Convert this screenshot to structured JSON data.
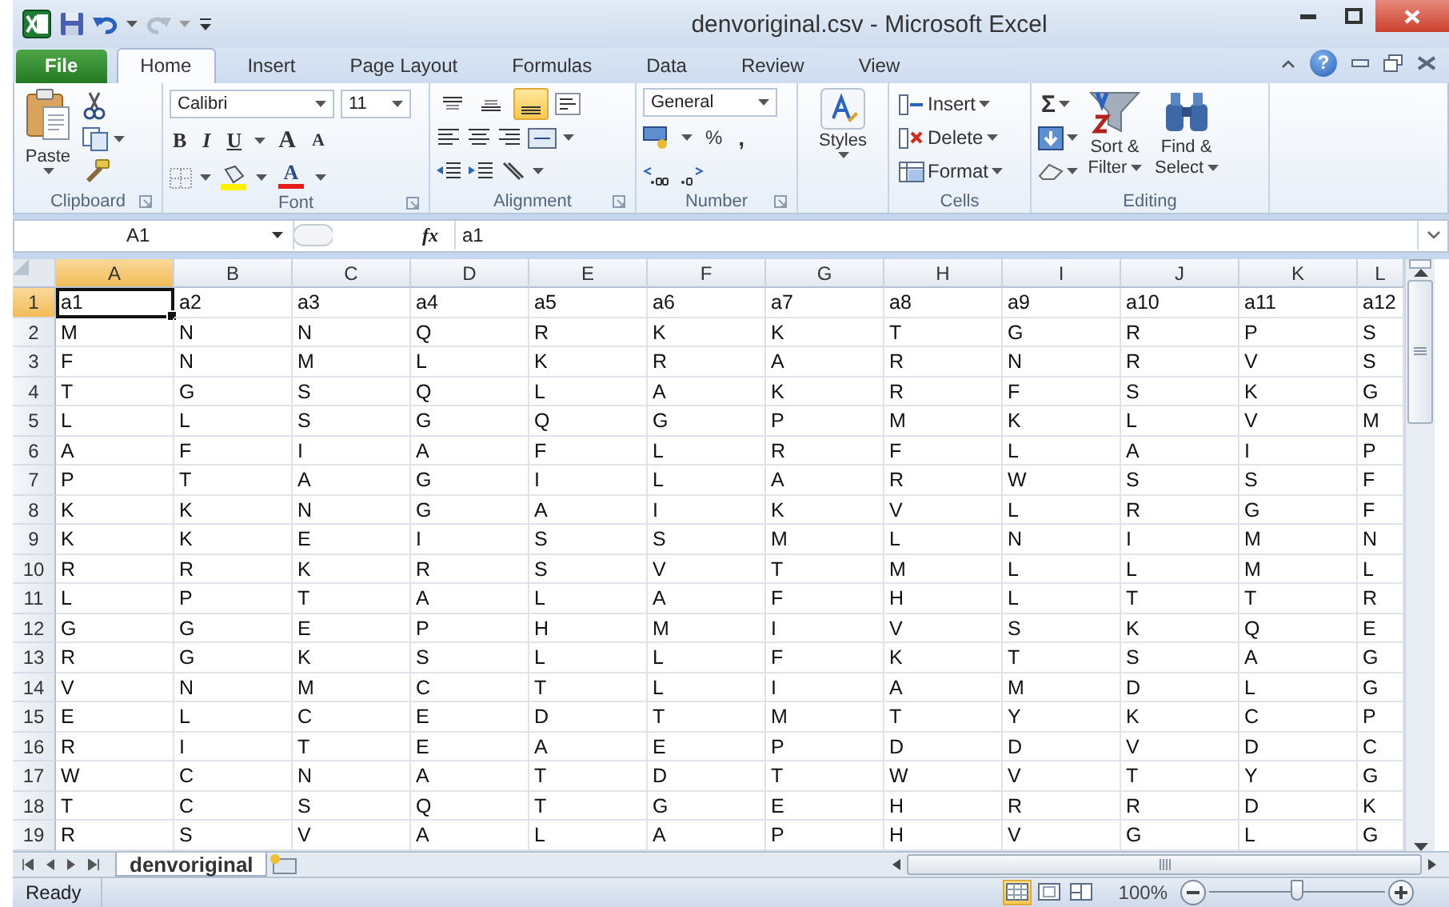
{
  "window": {
    "title": "denvoriginal.csv - Microsoft Excel"
  },
  "ribbon_tabs": [
    {
      "label": "File",
      "kind": "file",
      "selected": false
    },
    {
      "label": "Home",
      "kind": "tab",
      "selected": true
    },
    {
      "label": "Insert",
      "kind": "tab",
      "selected": false
    },
    {
      "label": "Page Layout",
      "kind": "tab",
      "selected": false
    },
    {
      "label": "Formulas",
      "kind": "tab",
      "selected": false
    },
    {
      "label": "Data",
      "kind": "tab",
      "selected": false
    },
    {
      "label": "Review",
      "kind": "tab",
      "selected": false
    },
    {
      "label": "View",
      "kind": "tab",
      "selected": false
    }
  ],
  "help_button": "?",
  "ribbon": {
    "clipboard": {
      "label": "Clipboard",
      "paste": "Paste"
    },
    "font": {
      "label": "Font",
      "name": "Calibri",
      "size": "11",
      "bold": "B",
      "italic": "I",
      "underline": "U",
      "grow": "A",
      "shrink": "A",
      "font_color_button": "A"
    },
    "alignment": {
      "label": "Alignment",
      "vertical": [
        {
          "selected": false
        },
        {
          "selected": false
        },
        {
          "selected": true
        }
      ]
    },
    "number": {
      "label": "Number",
      "format": "General",
      "percent": "%",
      "comma": ","
    },
    "styles": {
      "label": "Styles"
    },
    "cells": {
      "label": "Cells",
      "buttons": [
        "Insert",
        "Delete",
        "Format"
      ]
    },
    "editing": {
      "label": "Editing",
      "autosum": "Σ",
      "sort": [
        "Sort &",
        "Filter"
      ],
      "find": [
        "Find &",
        "Select"
      ]
    }
  },
  "formula_bar": {
    "name_box": "A1",
    "fx": "fx",
    "formula": "a1"
  },
  "sheet": {
    "columns": [
      {
        "label": "A",
        "selected": true
      },
      {
        "label": "B",
        "selected": false
      },
      {
        "label": "C",
        "selected": false
      },
      {
        "label": "D",
        "selected": false
      },
      {
        "label": "E",
        "selected": false
      },
      {
        "label": "F",
        "selected": false
      },
      {
        "label": "G",
        "selected": false
      },
      {
        "label": "H",
        "selected": false
      },
      {
        "label": "I",
        "selected": false
      },
      {
        "label": "J",
        "selected": false
      },
      {
        "label": "K",
        "selected": false
      },
      {
        "label": "L",
        "selected": false
      }
    ],
    "rows": [
      {
        "number": "1",
        "selected": true,
        "cells": [
          "a1",
          "a2",
          "a3",
          "a4",
          "a5",
          "a6",
          "a7",
          "a8",
          "a9",
          "a10",
          "a11",
          "a12"
        ]
      },
      {
        "number": "2",
        "selected": false,
        "cells": [
          "M",
          "N",
          "N",
          "Q",
          "R",
          "K",
          "K",
          "T",
          "G",
          "R",
          "P",
          "S"
        ]
      },
      {
        "number": "3",
        "selected": false,
        "cells": [
          "F",
          "N",
          "M",
          "L",
          "K",
          "R",
          "A",
          "R",
          "N",
          "R",
          "V",
          "S"
        ]
      },
      {
        "number": "4",
        "selected": false,
        "cells": [
          "T",
          "G",
          "S",
          "Q",
          "L",
          "A",
          "K",
          "R",
          "F",
          "S",
          "K",
          "G"
        ]
      },
      {
        "number": "5",
        "selected": false,
        "cells": [
          "L",
          "L",
          "S",
          "G",
          "Q",
          "G",
          "P",
          "M",
          "K",
          "L",
          "V",
          "M"
        ]
      },
      {
        "number": "6",
        "selected": false,
        "cells": [
          "A",
          "F",
          "I",
          "A",
          "F",
          "L",
          "R",
          "F",
          "L",
          "A",
          "I",
          "P"
        ]
      },
      {
        "number": "7",
        "selected": false,
        "cells": [
          "P",
          "T",
          "A",
          "G",
          "I",
          "L",
          "A",
          "R",
          "W",
          "S",
          "S",
          "F"
        ]
      },
      {
        "number": "8",
        "selected": false,
        "cells": [
          "K",
          "K",
          "N",
          "G",
          "A",
          "I",
          "K",
          "V",
          "L",
          "R",
          "G",
          "F"
        ]
      },
      {
        "number": "9",
        "selected": false,
        "cells": [
          "K",
          "K",
          "E",
          "I",
          "S",
          "S",
          "M",
          "L",
          "N",
          "I",
          "M",
          "N"
        ]
      },
      {
        "number": "10",
        "selected": false,
        "cells": [
          "R",
          "R",
          "K",
          "R",
          "S",
          "V",
          "T",
          "M",
          "L",
          "L",
          "M",
          "L"
        ]
      },
      {
        "number": "11",
        "selected": false,
        "cells": [
          "L",
          "P",
          "T",
          "A",
          "L",
          "A",
          "F",
          "H",
          "L",
          "T",
          "T",
          "R"
        ]
      },
      {
        "number": "12",
        "selected": false,
        "cells": [
          "G",
          "G",
          "E",
          "P",
          "H",
          "M",
          "I",
          "V",
          "S",
          "K",
          "Q",
          "E"
        ]
      },
      {
        "number": "13",
        "selected": false,
        "cells": [
          "R",
          "G",
          "K",
          "S",
          "L",
          "L",
          "F",
          "K",
          "T",
          "S",
          "A",
          "G"
        ]
      },
      {
        "number": "14",
        "selected": false,
        "cells": [
          "V",
          "N",
          "M",
          "C",
          "T",
          "L",
          "I",
          "A",
          "M",
          "D",
          "L",
          "G"
        ]
      },
      {
        "number": "15",
        "selected": false,
        "cells": [
          "E",
          "L",
          "C",
          "E",
          "D",
          "T",
          "M",
          "T",
          "Y",
          "K",
          "C",
          "P"
        ]
      },
      {
        "number": "16",
        "selected": false,
        "cells": [
          "R",
          "I",
          "T",
          "E",
          "A",
          "E",
          "P",
          "D",
          "D",
          "V",
          "D",
          "C"
        ]
      },
      {
        "number": "17",
        "selected": false,
        "cells": [
          "W",
          "C",
          "N",
          "A",
          "T",
          "D",
          "T",
          "W",
          "V",
          "T",
          "Y",
          "G"
        ]
      },
      {
        "number": "18",
        "selected": false,
        "cells": [
          "T",
          "C",
          "S",
          "Q",
          "T",
          "G",
          "E",
          "H",
          "R",
          "R",
          "D",
          "K"
        ]
      },
      {
        "number": "19",
        "selected": false,
        "cells": [
          "R",
          "S",
          "V",
          "A",
          "L",
          "A",
          "P",
          "H",
          "V",
          "G",
          "L",
          "G"
        ]
      }
    ]
  },
  "sheet_tabs": [
    {
      "label": "denvoriginal",
      "selected": true
    }
  ],
  "status_bar": {
    "status": "Ready",
    "views": [
      {
        "kind": "normal",
        "selected": true
      },
      {
        "kind": "page_layout",
        "selected": false
      },
      {
        "kind": "page_break",
        "selected": false
      }
    ],
    "zoom": "100%",
    "zoom_slider": {
      "level": 0.5
    }
  }
}
